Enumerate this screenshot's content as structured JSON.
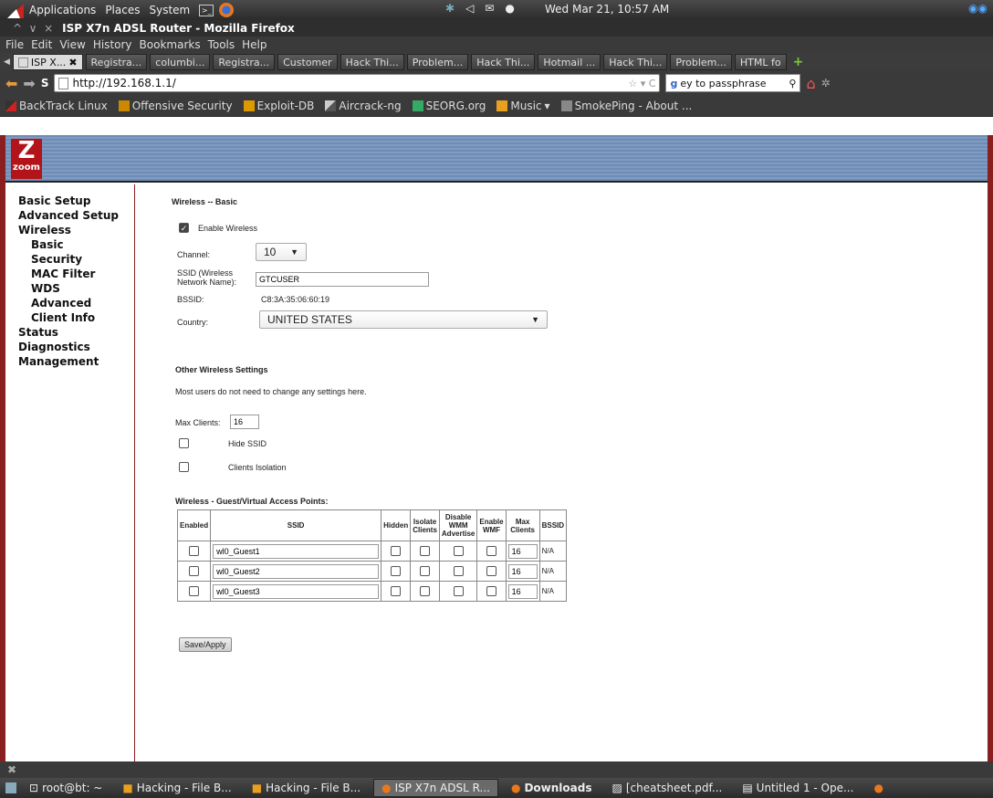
{
  "top_panel": {
    "menus": [
      "Applications",
      "Places",
      "System"
    ],
    "clock": "Wed Mar 21, 10:57 AM"
  },
  "window": {
    "title": "ISP X7n ADSL Router - Mozilla Firefox"
  },
  "menubar": [
    "File",
    "Edit",
    "View",
    "History",
    "Bookmarks",
    "Tools",
    "Help"
  ],
  "tabs": [
    "ISP X...",
    "Registra...",
    "columbi...",
    "Registra...",
    "Customer",
    "Hack Thi...",
    "Problem...",
    "Hack Thi...",
    "Hotmail ...",
    "Hack Thi...",
    "Problem...",
    "HTML fo"
  ],
  "nav": {
    "url": "http://192.168.1.1/",
    "search": "ey to passphrase"
  },
  "bookmarks": [
    "BackTrack Linux",
    "Offensive Security",
    "Exploit-DB",
    "Aircrack-ng",
    "SEORG.org",
    "Music",
    "SmokePing - About ..."
  ],
  "logo": {
    "letter": "Z",
    "text": "zoom"
  },
  "sidebar": {
    "items": [
      "Basic Setup",
      "Advanced Setup",
      "Wireless",
      "Basic",
      "Security",
      "MAC Filter",
      "WDS",
      "Advanced",
      "Client Info",
      "Status",
      "Diagnostics",
      "Management"
    ]
  },
  "basic": {
    "heading": "Wireless -- Basic",
    "enable_label": "Enable Wireless",
    "channel_label": "Channel:",
    "channel_value": "10",
    "ssid_label": "SSID (Wireless Network Name):",
    "ssid_value": "GTCUSER",
    "bssid_label": "BSSID:",
    "bssid_value": "C8:3A:35:06:60:19",
    "country_label": "Country:",
    "country_value": "UNITED STATES"
  },
  "other": {
    "heading": "Other Wireless Settings",
    "note": "Most users do not need to change any settings here.",
    "max_clients_label": "Max Clients:",
    "max_clients_value": "16",
    "hide_ssid_label": "Hide SSID",
    "isolation_label": "Clients Isolation"
  },
  "guest": {
    "heading": "Wireless - Guest/Virtual Access Points:",
    "headers": {
      "enabled": "Enabled",
      "ssid": "SSID",
      "hidden": "Hidden",
      "isolate": "Isolate Clients",
      "wmm": "Disable WMM Advertise",
      "wmf": "Enable WMF",
      "max": "Max Clients",
      "bssid": "BSSID"
    },
    "rows": [
      {
        "ssid": "wl0_Guest1",
        "max": "16",
        "bssid": "N/A"
      },
      {
        "ssid": "wl0_Guest2",
        "max": "16",
        "bssid": "N/A"
      },
      {
        "ssid": "wl0_Guest3",
        "max": "16",
        "bssid": "N/A"
      }
    ]
  },
  "save_label": "Save/Apply",
  "taskbar": [
    "root@bt: ~",
    "Hacking - File B...",
    "Hacking - File B...",
    "ISP X7n ADSL R...",
    "Downloads",
    "[cheatsheet.pdf...",
    "Untitled 1 - Ope..."
  ]
}
